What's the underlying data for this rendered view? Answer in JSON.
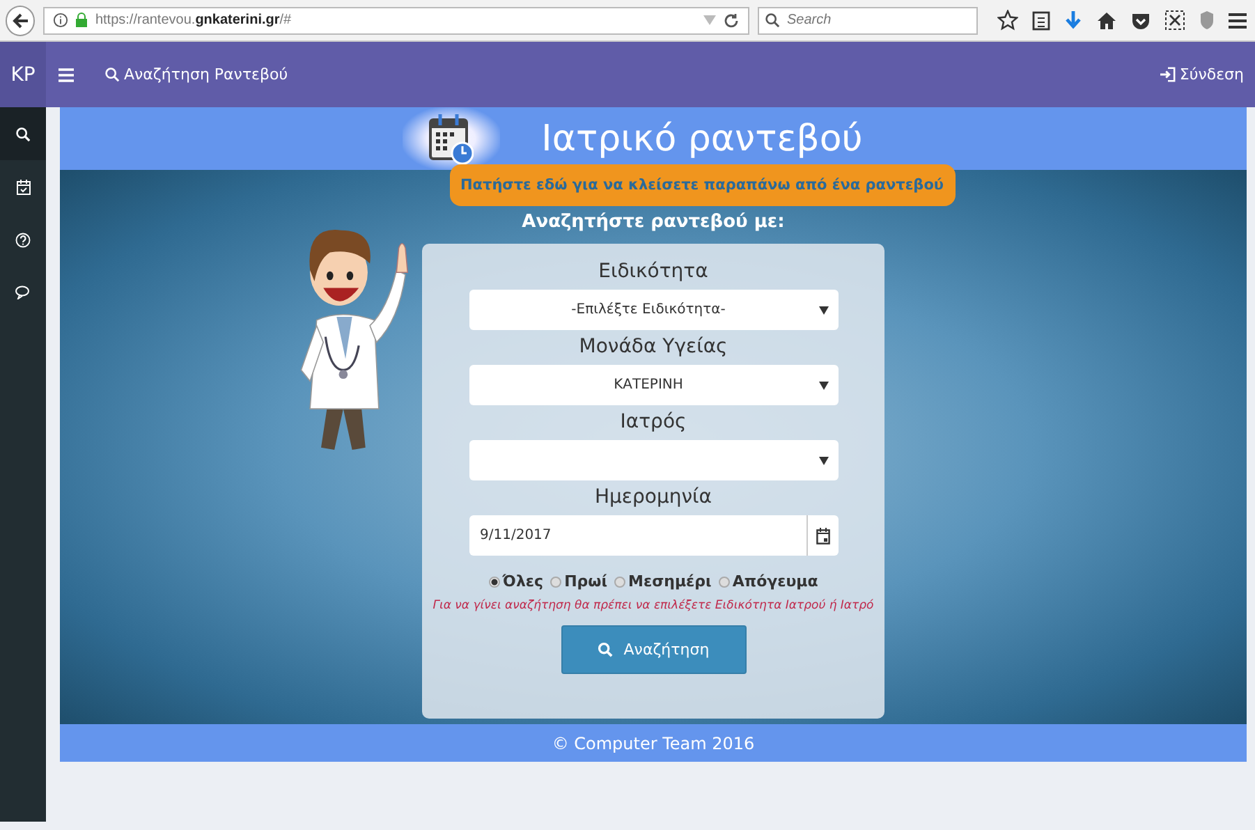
{
  "browser": {
    "url": "https://rantevou.**gnkaterini.gr**/#",
    "search_placeholder": "Search"
  },
  "navbar": {
    "brand": "KP",
    "link": "Αναζήτηση Ραντεβού",
    "login": "Σύνδεση"
  },
  "sidebar": {
    "items": [
      {
        "kind": "search",
        "selected": true
      },
      {
        "kind": "calendar",
        "selected": false
      },
      {
        "kind": "help",
        "selected": false
      },
      {
        "kind": "chat",
        "selected": false
      }
    ]
  },
  "banner": {
    "title": "Ιατρικό ραντεβού"
  },
  "callout": "Πατήστε εδώ για να κλείσετε παραπάνω από ένα ραντεβού",
  "form": {
    "heading": "Αναζητήστε ραντεβού με:",
    "fields": [
      {
        "label": "Ειδικότητα",
        "kind": "select",
        "value": "-Επιλέξτε Ειδικότητα-"
      },
      {
        "label": "Μονάδα Υγείας",
        "kind": "select",
        "value": "ΚΑΤΕΡΙΝΗ"
      },
      {
        "label": "Ιατρός",
        "kind": "select"
      },
      {
        "label": "Ημερομηνία",
        "kind": "date",
        "value": "9/11/2017"
      }
    ],
    "time_options": [
      {
        "label": "Όλες",
        "selected": true
      },
      {
        "label": "Πρωί",
        "selected": false
      },
      {
        "label": "Μεσημέρι",
        "selected": false
      },
      {
        "label": "Απόγευμα",
        "selected": false
      }
    ],
    "warning": "Για να γίνει αναζήτηση θα πρέπει να επιλέξετε Ειδικότητα Ιατρού ή Ιατρό",
    "search_button": "Αναζήτηση"
  },
  "footer": "© Computer Team 2016"
}
